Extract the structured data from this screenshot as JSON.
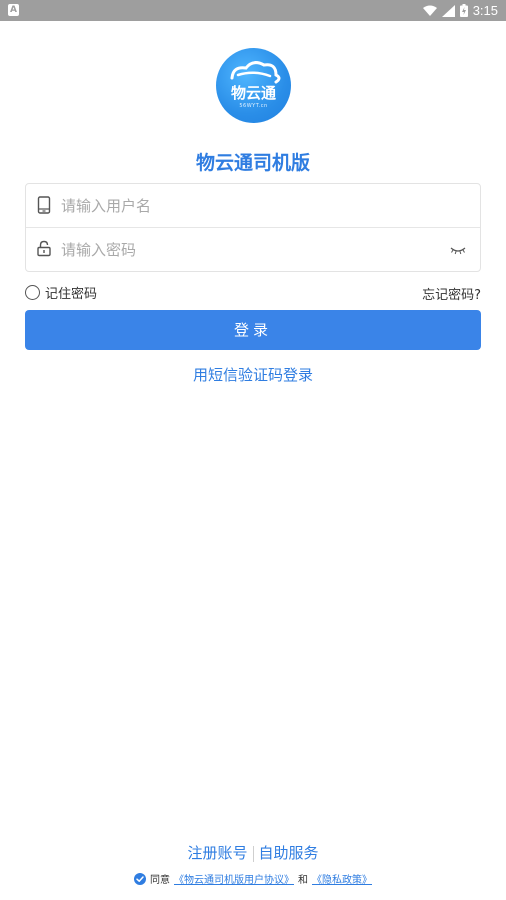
{
  "status_bar": {
    "notification_icon": "A",
    "time": "3:15",
    "icons": [
      "wifi-icon",
      "signal-icon",
      "battery-icon"
    ]
  },
  "logo": {
    "text": "物云通",
    "subtext": "56WYT.cn"
  },
  "app_title": "物云通司机版",
  "form": {
    "username_placeholder": "请输入用户名",
    "password_placeholder": "请输入密码"
  },
  "remember_label": "记住密码",
  "forgot_label": "忘记密码?",
  "login_button": "登录",
  "sms_login": "用短信验证码登录",
  "bottom": {
    "register": "注册账号",
    "self_service": "自助服务"
  },
  "agreement": {
    "prefix": "同意",
    "user_agreement": "《物云通司机版用户协议》",
    "and": "和",
    "privacy_policy": "《隐私政策》"
  },
  "colors": {
    "accent": "#2f7de1",
    "button": "#3a84e8",
    "status_bar": "#9e9e9e"
  }
}
